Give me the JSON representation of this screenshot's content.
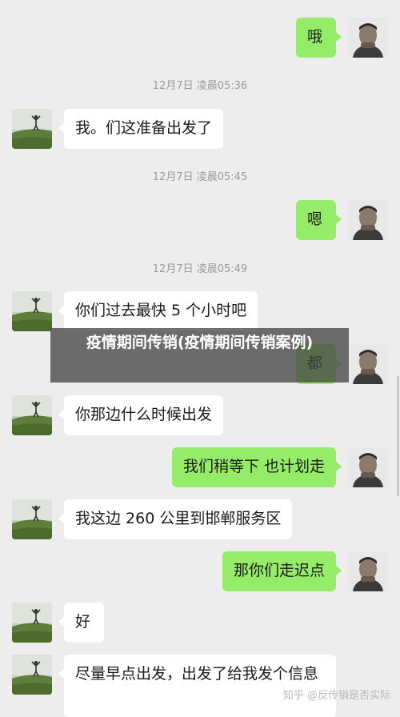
{
  "messages": [
    {
      "side": "out",
      "text": "哦"
    },
    {
      "timestamp": "12月7日 凌晨05:36"
    },
    {
      "side": "in",
      "text": "我。们这准备出发了"
    },
    {
      "timestamp": "12月7日 凌晨05:45"
    },
    {
      "side": "out",
      "text": "嗯"
    },
    {
      "timestamp": "12月7日 凌晨05:49"
    },
    {
      "side": "in",
      "text": "你们过去最快 5 个小时吧"
    },
    {
      "side": "out",
      "text": "都"
    },
    {
      "side": "in",
      "text": "你那边什么时候出发"
    },
    {
      "side": "out",
      "text": "我们稍等下  也计划走"
    },
    {
      "side": "in",
      "text": "我这边 260 公里到邯郸服务区"
    },
    {
      "side": "out",
      "text": "那你们走迟点"
    },
    {
      "side": "in",
      "text": "好"
    },
    {
      "side": "in",
      "text": "尽量早点出发，出发了给我发个信息"
    }
  ],
  "overlay_title": "疫情期间传销(疫情期间传销案例)",
  "watermark": "知乎 @反传销是否实际",
  "colors": {
    "background": "#ededed",
    "incoming_bubble": "#ffffff",
    "outgoing_bubble": "#95ec69"
  },
  "icons": {
    "contact_avatar": "person-on-hill-avatar",
    "self_avatar": "man-portrait-avatar"
  }
}
